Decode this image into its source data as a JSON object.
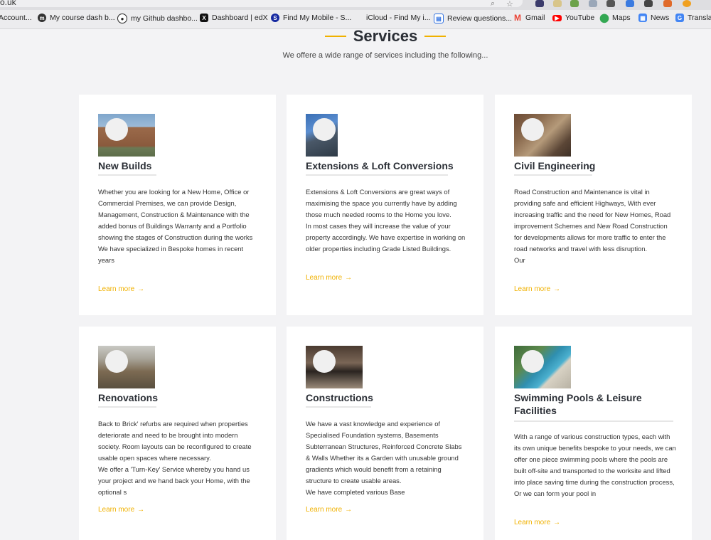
{
  "browser": {
    "url_fragment": "o.uk",
    "bookmarks": [
      {
        "label": "Account...",
        "icon": "google-icon",
        "color": "#4285f4"
      },
      {
        "label": "My course dash b...",
        "icon": "moodle-icon",
        "color": "#333333"
      },
      {
        "label": "my Github dashbo...",
        "icon": "github-icon",
        "color": "#222222"
      },
      {
        "label": "Dashboard | edX",
        "icon": "edx-icon",
        "color": "#111111"
      },
      {
        "label": "Find My Mobile - S...",
        "icon": "samsung-icon",
        "color": "#1428a0"
      },
      {
        "label": "iCloud - Find My i...",
        "icon": "apple-icon",
        "color": "#666666"
      },
      {
        "label": "Review questions...",
        "icon": "doc-icon",
        "color": "#2d6fe0"
      },
      {
        "label": "Gmail",
        "icon": "gmail-icon",
        "color": "#ea4335"
      },
      {
        "label": "YouTube",
        "icon": "youtube-icon",
        "color": "#ff0000"
      },
      {
        "label": "Maps",
        "icon": "maps-icon",
        "color": "#34a853"
      },
      {
        "label": "News",
        "icon": "news-icon",
        "color": "#4285f4"
      },
      {
        "label": "Translat",
        "icon": "translate-icon",
        "color": "#4285f4"
      }
    ]
  },
  "section": {
    "title": "Services",
    "subtitle": "We offere a wide range of services including the following...",
    "accent": "#f0b100"
  },
  "cards": [
    {
      "title": "New Builds",
      "body": "Whether you are looking for a New Home, Office or Commercial Premises, we can provide Design, Management, Construction & Maintenance with the added bonus of Buildings Warranty and a Portfolio showing the stages of Construction during the works\nWe have specialized in Bespoke homes in recent years",
      "link": "Learn more",
      "arrow": "→",
      "image": "house-photo"
    },
    {
      "title": "Extensions & Loft Conversions",
      "body": "Extensions & Loft Conversions are great ways of maximising the space you currently have by adding those much needed rooms to the Home you love.\nIn most cases they will increase the value of your property accordingly. We have expertise in working on older properties including Grade Listed Buildings.",
      "link": "Learn more",
      "arrow": "→",
      "image": "extension-photo"
    },
    {
      "title": "Civil Engineering",
      "body": "Road Construction and Maintenance is vital in providing safe and efficient Highways, With ever increasing traffic and the need for New Homes, Road improvement Schemes and New Road Construction for developments allows for more traffic to enter the road networks and travel with less disruption.\nOur",
      "link": "Learn more",
      "arrow": "→",
      "image": "civil-photo"
    },
    {
      "title": "Renovations",
      "body": "Back to Brick' refurbs are required when properties deteriorate and need to be brought into modern society. Room layouts can be reconfigured to create usable open spaces where necessary.\nWe offer a 'Turn-Key' Service whereby you hand us your project and we hand back your Home, with the optional s",
      "link": "Learn more",
      "arrow": "→",
      "image": "renovation-photo"
    },
    {
      "title": "Constructions",
      "body": "We have a vast knowledge and experience of Specialised Foundation systems, Basements Subterranean Structures, Reinforced Concrete Slabs & Walls Whether its a Garden with unusable ground gradients which would benefit from a retaining structure to create usable areas.\nWe have completed various Base",
      "link": "Learn more",
      "arrow": "→",
      "image": "foundation-photo"
    },
    {
      "title": "Swimming Pools & Leisure Facilities",
      "body": "With a range of various construction types, each with its own unique benefits bespoke to your needs, we can offer one piece swimming pools where the pools are built off-site and transported to the worksite and lifted into place saving time during the construction process, Or we can form your pool in",
      "link": "Learn more",
      "arrow": "→",
      "image": "pool-photo"
    }
  ]
}
